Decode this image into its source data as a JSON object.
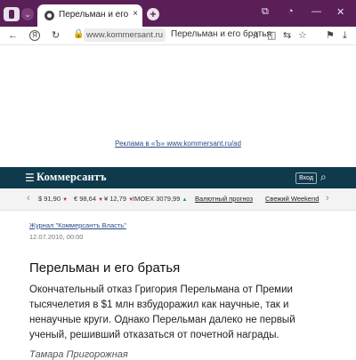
{
  "browser": {
    "tab": {
      "title": "Перельман и его братья",
      "close_icon": "×"
    },
    "new_tab_icon": "+",
    "address": {
      "host": "www.kommersant.ru",
      "page_title": "Перельман и его братья"
    }
  },
  "ad": {
    "link_text": "Реклама в «Ъ» www.kommersant.ru/ad"
  },
  "site": {
    "logo": "Коммерсантъ",
    "login_label": "Вход"
  },
  "ticker": {
    "usd": "$ 91,90",
    "eur": "€ 98,64",
    "cny": "¥ 12,79",
    "imoex": "IMOEX 3079,99",
    "forecast": "Валютный прогноз",
    "weekend": "Свежий Weekend"
  },
  "article": {
    "source": "Журнал \"Коммерсантъ Власть\"",
    "date": "12.07.2010, 00:00",
    "headline": "Перельман и его братья",
    "lead": "Окончательный отказ Григория Перельмана от Премии тысячелетия в $1 млн взбудоражил как научные, так и ненаучные круги. Однако Перельман далеко не первый ученый, решивший отказаться от почетной награды.",
    "author": "Тамара Пригорожная"
  },
  "colors": {
    "tabstrip": "#5b1f58",
    "site_header": "#0f3a4c",
    "down": "#c0272d",
    "up": "#2c9a3e"
  }
}
